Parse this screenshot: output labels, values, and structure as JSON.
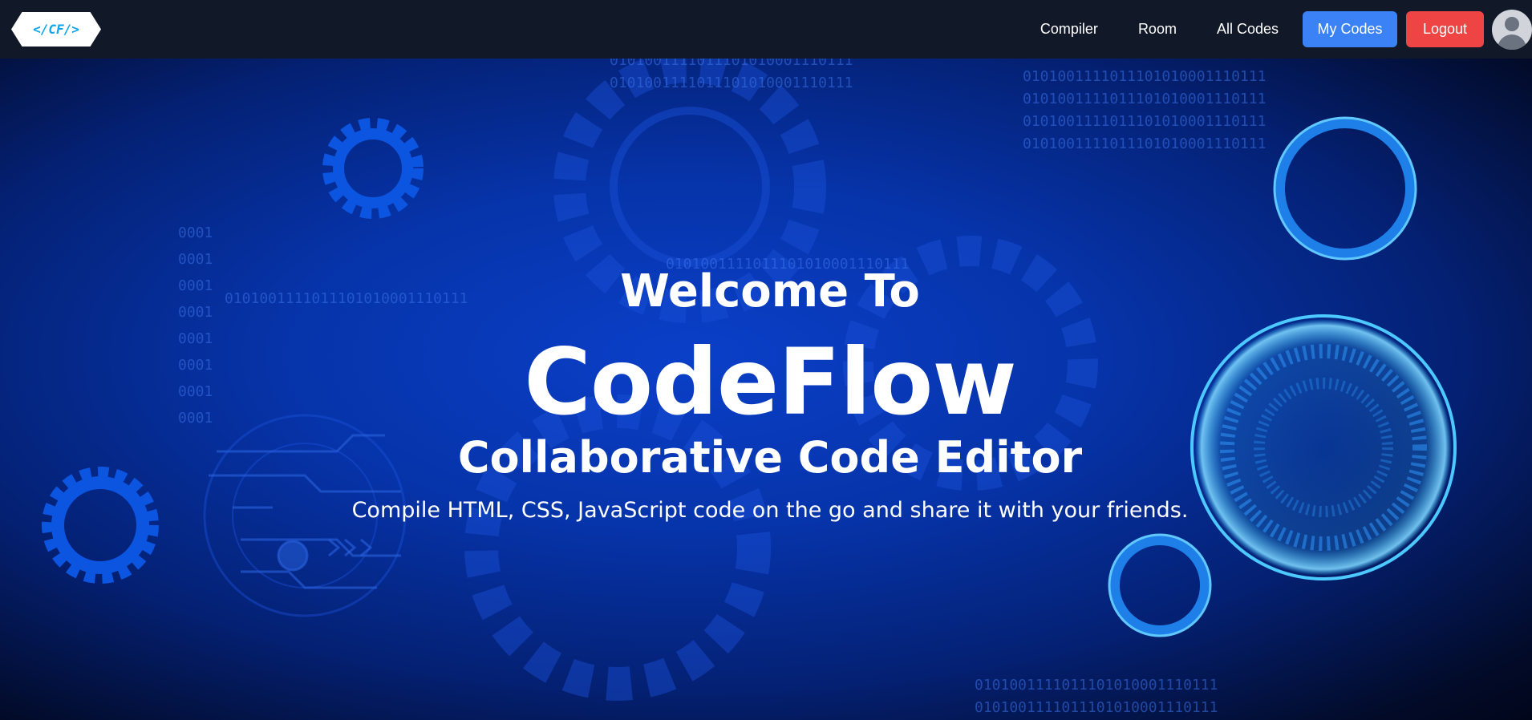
{
  "logo": {
    "text": "</CF/>"
  },
  "nav": {
    "compiler": "Compiler",
    "room": "Room",
    "all_codes": "All Codes",
    "my_codes": "My Codes",
    "logout": "Logout"
  },
  "hero": {
    "welcome": "Welcome To",
    "brand": "CodeFlow",
    "subtitle": "Collaborative Code Editor",
    "description": "Compile HTML, CSS, JavaScript code on the go and share it with your friends."
  },
  "colors": {
    "navbar_bg": "#111827",
    "my_codes_button": "#3b82f6",
    "logout_button": "#ef4444",
    "hero_blue": "#0633a8"
  },
  "icons": [
    "user-avatar-icon",
    "gear-icon",
    "ring-icon"
  ]
}
